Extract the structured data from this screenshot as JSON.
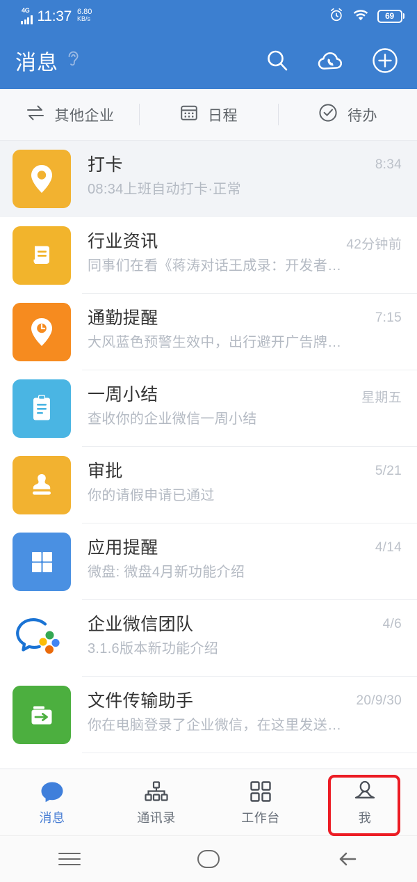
{
  "status_bar": {
    "network_type": "4G",
    "time": "11:37",
    "speed_value": "6.80",
    "speed_unit": "KB/s",
    "alarm_icon": "alarm-clock-icon",
    "wifi_icon": "wifi-icon",
    "battery_level": "69",
    "background_color": "#3c7fd0"
  },
  "header": {
    "title": "消息",
    "mute_icon": "ear-icon",
    "actions": [
      {
        "name": "search-icon",
        "label": "搜索"
      },
      {
        "name": "cloud-call-icon",
        "label": "云通话"
      },
      {
        "name": "plus-circle-icon",
        "label": "添加"
      }
    ],
    "background_color": "#3c7fd0"
  },
  "quick_tabs": [
    {
      "icon": "switch-arrows-icon",
      "label": "其他企业"
    },
    {
      "icon": "calendar-icon",
      "label": "日程"
    },
    {
      "icon": "check-circle-icon",
      "label": "待办"
    }
  ],
  "messages": [
    {
      "title": "打卡",
      "subtitle": "08:34上班自动打卡·正常",
      "time": "8:34",
      "icon": "location-pin-icon",
      "tile_color": "#f2b230",
      "pressed": true
    },
    {
      "title": "行业资讯",
      "subtitle": "同事们在看《蒋涛对话王成录：开发者…",
      "time": "42分钟前",
      "icon": "news-document-icon",
      "tile_color": "#f2b42c",
      "pressed": false
    },
    {
      "title": "通勤提醒",
      "subtitle": "大风蓝色预警生效中，出行避开广告牌…",
      "time": "7:15",
      "icon": "clock-pin-icon",
      "tile_color": "#f68b1f",
      "pressed": false
    },
    {
      "title": "一周小结",
      "subtitle": "查收你的企业微信一周小结",
      "time": "星期五",
      "icon": "clipboard-icon",
      "tile_color": "#4ab5e3",
      "pressed": false
    },
    {
      "title": "审批",
      "subtitle": "你的请假申请已通过",
      "time": "5/21",
      "icon": "stamp-icon",
      "tile_color": "#f2b230",
      "pressed": false
    },
    {
      "title": "应用提醒",
      "subtitle": "微盘: 微盘4月新功能介绍",
      "time": "4/14",
      "icon": "grid-apps-icon",
      "tile_color": "#4a90e2",
      "pressed": false
    },
    {
      "title": "企业微信团队",
      "subtitle": "3.1.6版本新功能介绍",
      "time": "4/6",
      "icon": "wecom-logo-icon",
      "tile_color": "transparent",
      "pressed": false
    },
    {
      "title": "文件传输助手",
      "subtitle": "你在电脑登录了企业微信，在这里发送…",
      "time": "20/9/30",
      "icon": "file-transfer-folder-icon",
      "tile_color": "#4caf3f",
      "pressed": false
    }
  ],
  "bottom_tabs": [
    {
      "icon": "chat-bubble-icon",
      "label": "消息",
      "active": true,
      "highlighted": false
    },
    {
      "icon": "org-tree-icon",
      "label": "通讯录",
      "active": false,
      "highlighted": false
    },
    {
      "icon": "workbench-grid-icon",
      "label": "工作台",
      "active": false,
      "highlighted": false
    },
    {
      "icon": "person-icon",
      "label": "我",
      "active": false,
      "highlighted": true
    }
  ],
  "highlight": {
    "color": "#ec1c24"
  },
  "android_nav": [
    {
      "icon": "menu-icon",
      "label": "菜单"
    },
    {
      "icon": "home-icon",
      "label": "主页"
    },
    {
      "icon": "back-arrow-icon",
      "label": "返回"
    }
  ]
}
